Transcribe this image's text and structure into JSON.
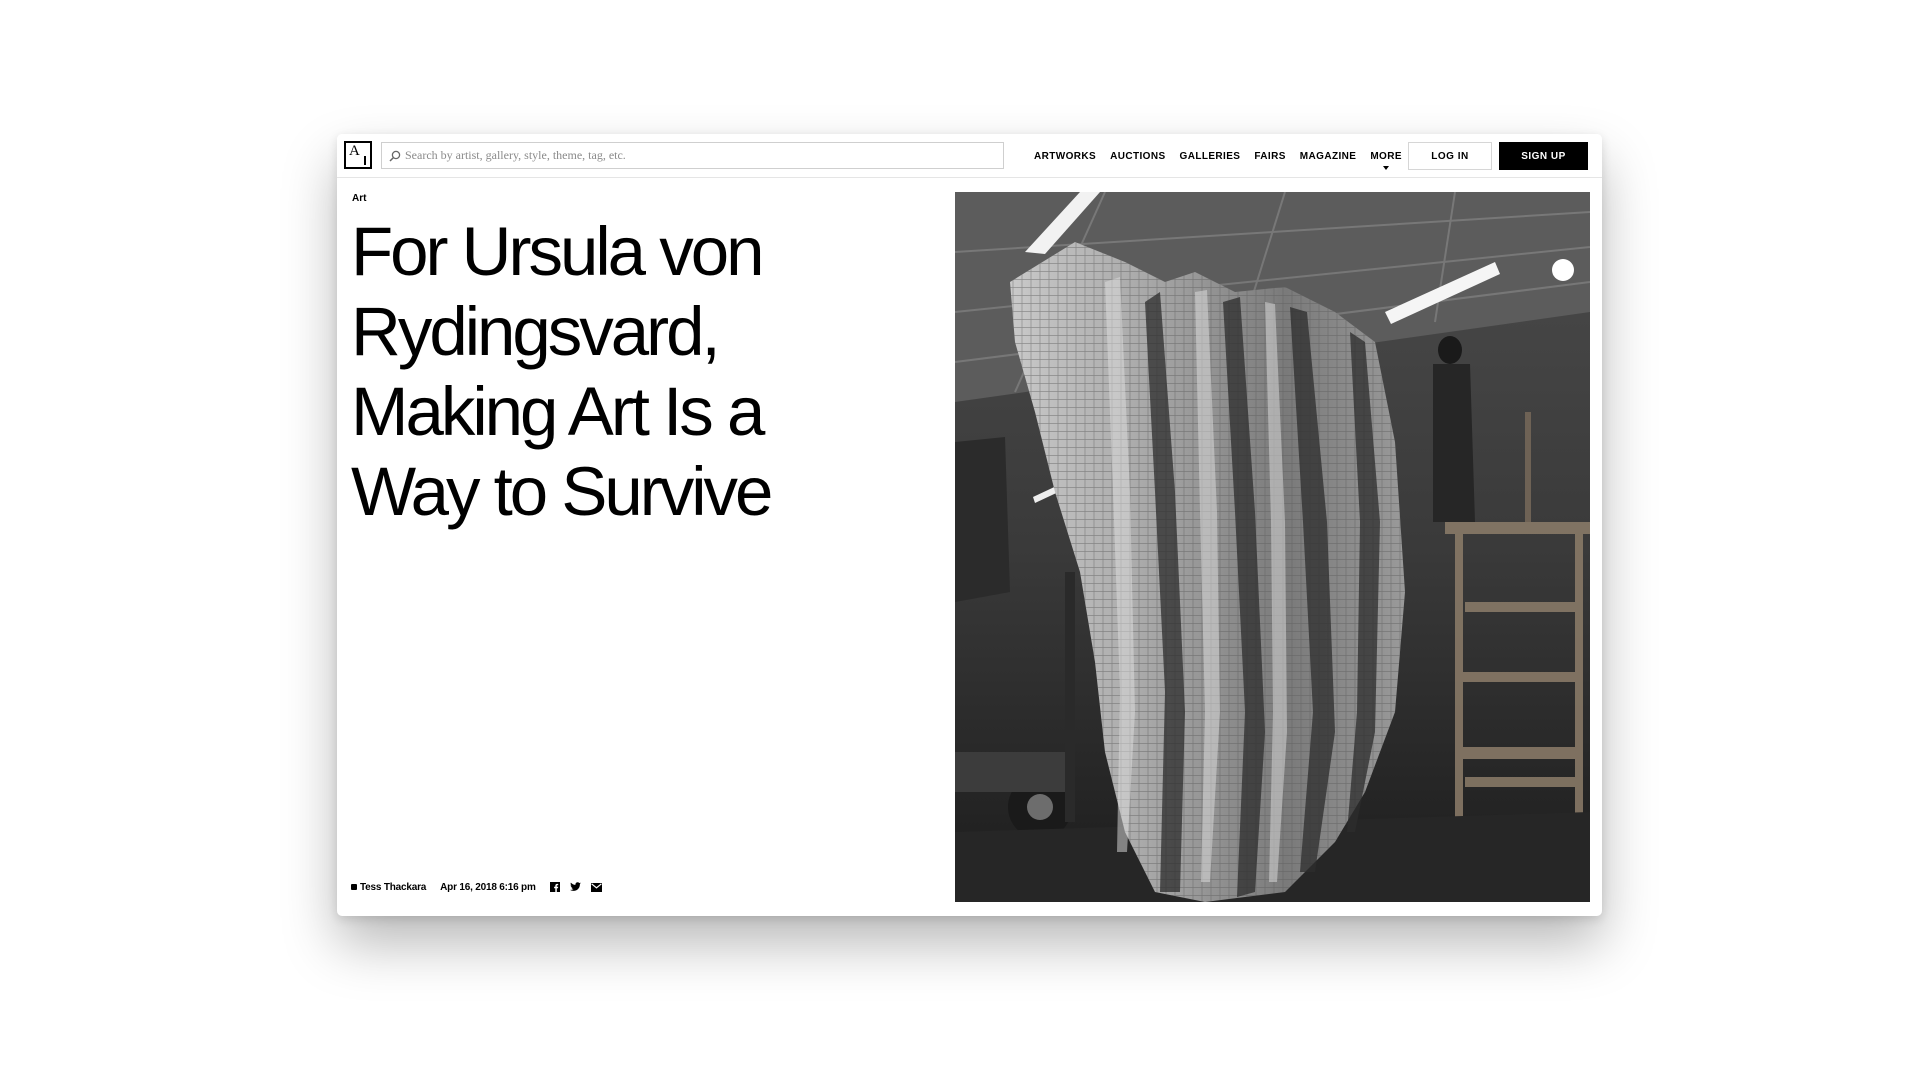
{
  "header": {
    "logo_icon": "artsy-logo-icon",
    "search": {
      "placeholder": "Search by artist, gallery, style, theme, tag, etc.",
      "value": "",
      "icon": "search-icon"
    },
    "nav": [
      {
        "label": "ARTWORKS"
      },
      {
        "label": "AUCTIONS"
      },
      {
        "label": "GALLERIES"
      },
      {
        "label": "FAIRS"
      },
      {
        "label": "MAGAZINE"
      },
      {
        "label": "MORE",
        "icon": "chevron-down-icon"
      }
    ],
    "login_label": "LOG IN",
    "signup_label": "SIGN UP"
  },
  "article": {
    "category": "Art",
    "title": "For Ursula von Rydingsvard, Making Art Is a Way to Survive",
    "author": "Tess Thackara",
    "date": "Apr 16, 2018 6:16 pm",
    "share_icons": [
      "facebook-icon",
      "twitter-icon",
      "email-icon"
    ]
  },
  "hero_image": {
    "icon": "hero-photo-sculpture"
  },
  "colors": {
    "text": "#000000",
    "background": "#ffffff",
    "button_dark": "#000000",
    "border": "#d6d6d6"
  }
}
